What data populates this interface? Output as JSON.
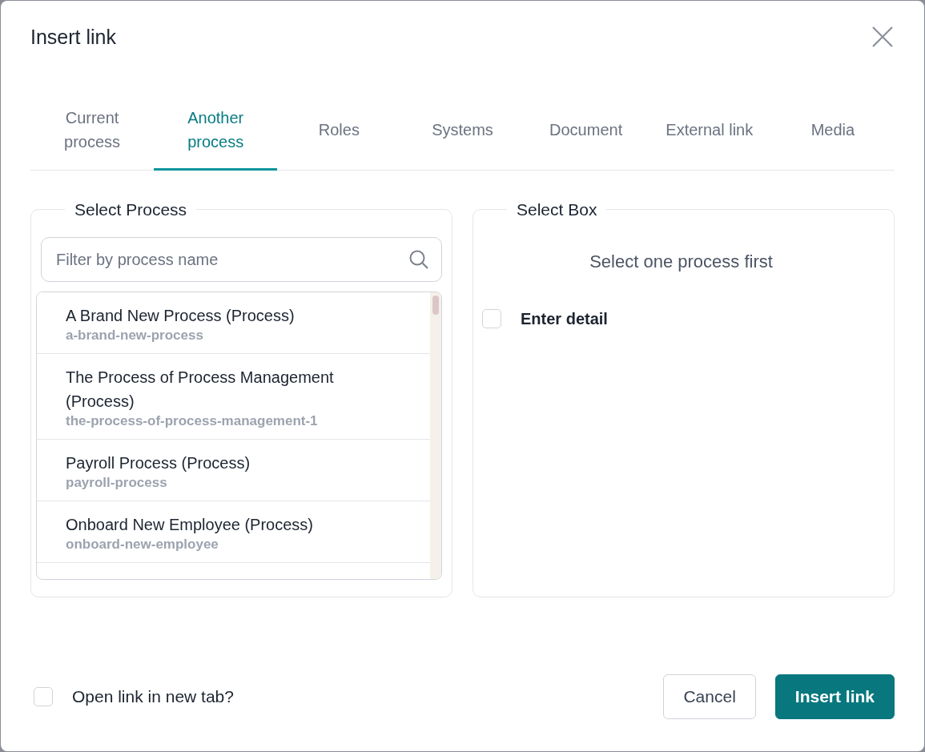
{
  "dialog": {
    "title": "Insert link"
  },
  "tabs": [
    {
      "label": "Current process",
      "selected": false
    },
    {
      "label": "Another process",
      "selected": true
    },
    {
      "label": "Roles",
      "selected": false
    },
    {
      "label": "Systems",
      "selected": false
    },
    {
      "label": "Document",
      "selected": false
    },
    {
      "label": "External link",
      "selected": false
    },
    {
      "label": "Media",
      "selected": false
    }
  ],
  "select_process": {
    "legend": "Select Process",
    "search": {
      "placeholder": "Filter by process name"
    },
    "items": [
      {
        "name": "A Brand New Process (Process)",
        "slug": "a-brand-new-process",
        "selected": false
      },
      {
        "name": "The Process of Process Management (Process)",
        "slug": "the-process-of-process-management-1",
        "selected": false
      },
      {
        "name": "Payroll Process (Process)",
        "slug": "payroll-process",
        "selected": false
      },
      {
        "name": "Onboard New Employee (Process)",
        "slug": "onboard-new-employee",
        "selected": false
      }
    ]
  },
  "select_box": {
    "legend": "Select Box",
    "message": "Select one process first",
    "enter_detail": {
      "label": "Enter detail",
      "checked": false
    }
  },
  "footer": {
    "new_tab": {
      "label": "Open link in new tab?",
      "checked": false
    },
    "buttons": [
      {
        "label": "Cancel",
        "kind": "secondary"
      },
      {
        "label": "Insert link",
        "kind": "primary"
      }
    ]
  }
}
